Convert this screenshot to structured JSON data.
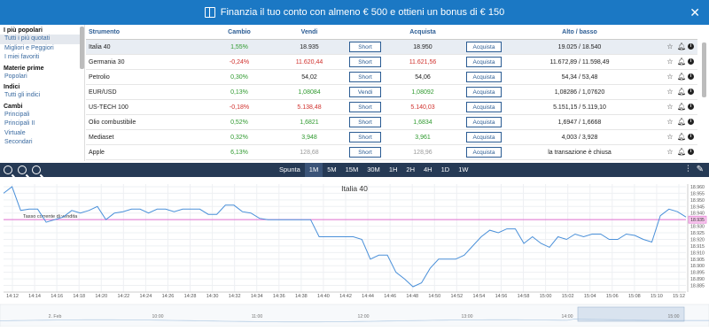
{
  "banner": {
    "text": "Finanzia il tuo conto con almeno € 500 e ottieni un bonus di € 150",
    "close": "✕"
  },
  "sidebar": {
    "sections": [
      {
        "title": "I più popolari",
        "items": [
          "Tutti i più quotati",
          "Migliori e Peggiori",
          "I miei favoriti"
        ]
      },
      {
        "title": "Materie prime",
        "items": [
          "Popolari"
        ]
      },
      {
        "title": "Indici",
        "items": [
          "Tutti gli indici"
        ]
      },
      {
        "title": "Cambi",
        "items": [
          "Principali",
          "Principali II",
          "Virtuale",
          "Secondari"
        ]
      }
    ]
  },
  "table": {
    "headers": {
      "name": "Strumento",
      "change": "Cambio",
      "sell": "Vendi",
      "buy": "Acquista",
      "range": "Alto / basso"
    },
    "rows": [
      {
        "name": "Italia 40",
        "change": "1,55%",
        "dir": "pos",
        "sell": "18.935",
        "sell_dir": "",
        "sell_btn": "Short",
        "buy": "18.950",
        "buy_dir": "",
        "buy_btn": "Acquista",
        "range": "19.025 / 18.540"
      },
      {
        "name": "Germania 30",
        "change": "-0,24%",
        "dir": "neg",
        "sell": "11.620,44",
        "sell_dir": "neg",
        "sell_btn": "Short",
        "buy": "11.621,56",
        "buy_dir": "neg",
        "buy_btn": "Acquista",
        "range": "11.672,89 / 11.598,49"
      },
      {
        "name": "Petrolio",
        "change": "0,30%",
        "dir": "pos",
        "sell": "54,02",
        "sell_dir": "",
        "sell_btn": "Short",
        "buy": "54,06",
        "buy_dir": "",
        "buy_btn": "Acquista",
        "range": "54,34 / 53,48"
      },
      {
        "name": "EUR/USD",
        "change": "0,13%",
        "dir": "pos",
        "sell": "1,08084",
        "sell_dir": "pos",
        "sell_btn": "Vendi",
        "buy": "1,08092",
        "buy_dir": "pos",
        "buy_btn": "Acquista",
        "range": "1,08286 / 1,07620"
      },
      {
        "name": "US-TECH 100",
        "change": "-0,18%",
        "dir": "neg",
        "sell": "5.138,48",
        "sell_dir": "neg",
        "sell_btn": "Short",
        "buy": "5.140,03",
        "buy_dir": "neg",
        "buy_btn": "Acquista",
        "range": "5.151,15 / 5.119,10"
      },
      {
        "name": "Olio combustibile",
        "change": "0,52%",
        "dir": "pos",
        "sell": "1,6821",
        "sell_dir": "pos",
        "sell_btn": "Short",
        "buy": "1,6834",
        "buy_dir": "pos",
        "buy_btn": "Acquista",
        "range": "1,6947 / 1,6668"
      },
      {
        "name": "Mediaset",
        "change": "0,32%",
        "dir": "pos",
        "sell": "3,948",
        "sell_dir": "pos",
        "sell_btn": "Short",
        "buy": "3,961",
        "buy_dir": "pos",
        "buy_btn": "Acquista",
        "range": "4,003 / 3,928"
      },
      {
        "name": "Apple",
        "change": "6,13%",
        "dir": "pos",
        "sell": "128,68",
        "sell_dir": "",
        "sell_btn": "Short",
        "buy": "128,96",
        "buy_dir": "",
        "buy_btn": "Acquista",
        "range": "la transazione è chiusa"
      }
    ]
  },
  "toolbar": {
    "timeframes": [
      "Spunta",
      "1M",
      "5M",
      "15M",
      "30M",
      "1H",
      "2H",
      "4H",
      "1D",
      "1W"
    ],
    "active": "1M"
  },
  "chart_data": {
    "type": "line",
    "title": "Italia 40",
    "current_rate_label": "Tasso corrente di vendita",
    "current_rate": 18935,
    "current_rate_text": "18.935",
    "ylim": [
      18880,
      18962
    ],
    "y_ticks": [
      "18.960",
      "18.955",
      "18.950",
      "18.945",
      "18.940",
      "18.935",
      "18.930",
      "18.925",
      "18.920",
      "18.915",
      "18.910",
      "18.905",
      "18.900",
      "18.895",
      "18.890",
      "18.885"
    ],
    "x_ticks": [
      "14:12",
      "14:14",
      "14:16",
      "14:18",
      "14:20",
      "14:22",
      "14:24",
      "14:26",
      "14:28",
      "14:30",
      "14:32",
      "14:34",
      "14:36",
      "14:38",
      "14:40",
      "14:42",
      "14:44",
      "14:46",
      "14:48",
      "14:50",
      "14:52",
      "14:54",
      "14:56",
      "14:58",
      "15:00",
      "15:02",
      "15:04",
      "15:06",
      "15:08",
      "15:10",
      "15:12"
    ],
    "values": [
      18955,
      18960,
      18942,
      18943,
      18943,
      18933,
      18935,
      18937,
      18942,
      18940,
      18942,
      18945,
      18935,
      18940,
      18941,
      18943,
      18943,
      18940,
      18943,
      18943,
      18941,
      18943,
      18943,
      18943,
      18939,
      18939,
      18946,
      18946,
      18941,
      18940,
      18936,
      18935,
      18935,
      18935,
      18935,
      18935,
      18935,
      18922,
      18922,
      18922,
      18922,
      18922,
      18920,
      18905,
      18908,
      18908,
      18895,
      18890,
      18884,
      18887,
      18898,
      18905,
      18905,
      18905,
      18908,
      18915,
      18922,
      18927,
      18925,
      18928,
      18928,
      18917,
      18922,
      18917,
      18914,
      18922,
      18920,
      18924,
      18922,
      18924,
      18924,
      18920,
      18920,
      18924,
      18923,
      18920,
      18918,
      18938,
      18943,
      18941,
      18937
    ],
    "navigator_labels": [
      "2. Feb",
      "10:00",
      "11:00",
      "12:00",
      "13:00",
      "14:00",
      "15:00"
    ]
  }
}
